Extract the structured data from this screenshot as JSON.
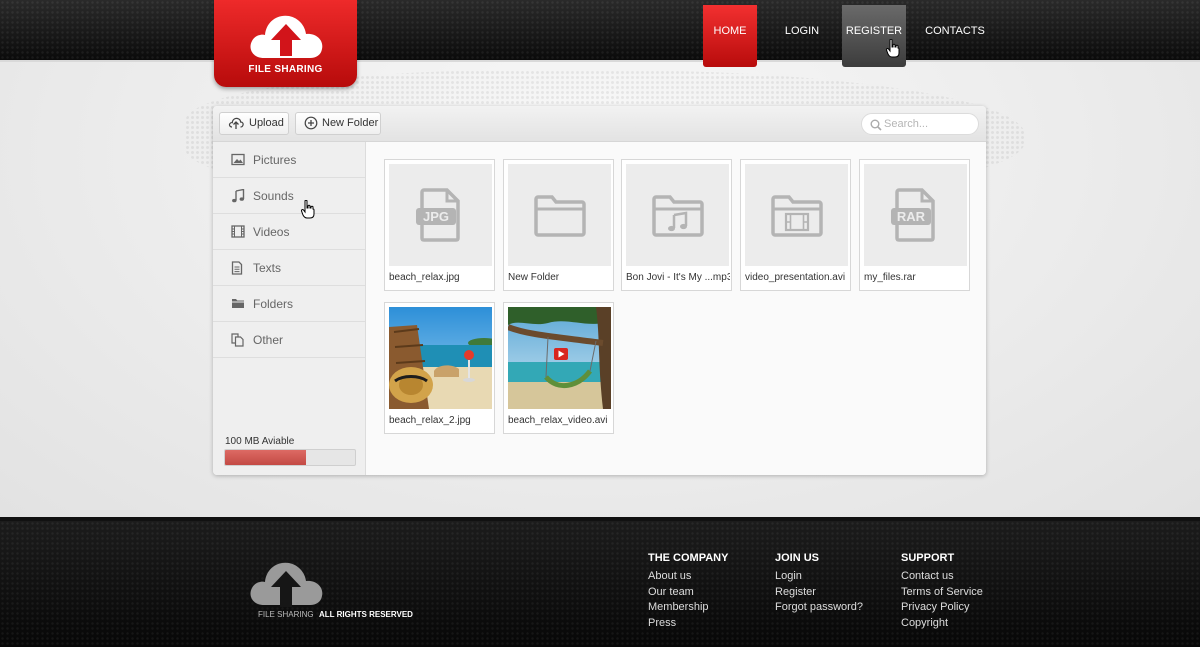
{
  "brand": {
    "name": "FILE SHARING"
  },
  "nav": {
    "home": "HOME",
    "login": "LOGIN",
    "register": "REGISTER",
    "contacts": "CONTACTS"
  },
  "toolbar": {
    "upload_label": "Upload",
    "new_folder_label": "New Folder",
    "search_placeholder": "Search..."
  },
  "sidebar": {
    "items": [
      {
        "label": "Pictures",
        "icon": "image-icon"
      },
      {
        "label": "Sounds",
        "icon": "music-note-icon"
      },
      {
        "label": "Videos",
        "icon": "film-icon"
      },
      {
        "label": "Texts",
        "icon": "document-icon"
      },
      {
        "label": "Folders",
        "icon": "folder-icon"
      },
      {
        "label": "Other",
        "icon": "copy-files-icon"
      }
    ],
    "storage": {
      "label": "100 MB Aviable",
      "used_fraction": 0.62
    }
  },
  "files": [
    {
      "name": "beach_relax.jpg",
      "type": "jpg-file-icon"
    },
    {
      "name": "New Folder",
      "type": "folder-icon"
    },
    {
      "name": "Bon Jovi - It's My ...mp3",
      "type": "music-folder-icon"
    },
    {
      "name": "video_presentation.avi",
      "type": "video-folder-icon"
    },
    {
      "name": "my_files.rar",
      "type": "rar-file-icon"
    },
    {
      "name": "beach_relax_2.jpg",
      "type": "beach-photo-thumbnail"
    },
    {
      "name": "beach_relax_video.avi",
      "type": "hammock-video-thumbnail"
    }
  ],
  "icon_labels": {
    "jpg": "JPG",
    "rar": "RAR"
  },
  "footer": {
    "logo_text": "FILE SHARING",
    "rights": "ALL RIGHTS RESERVED",
    "columns": [
      {
        "title": "THE COMPANY",
        "links": [
          "About us",
          "Our team",
          "Membership",
          "Press"
        ]
      },
      {
        "title": "JOIN US",
        "links": [
          "Login",
          "Register",
          "Forgot password?"
        ]
      },
      {
        "title": "SUPPORT",
        "links": [
          "Contact us",
          "Terms of Service",
          "Privacy Policy",
          "Copyright"
        ]
      }
    ]
  },
  "colors": {
    "brand_red": "#d4141a",
    "active_nav_gray": "#555555",
    "storage_fill": "#cf5a54"
  }
}
